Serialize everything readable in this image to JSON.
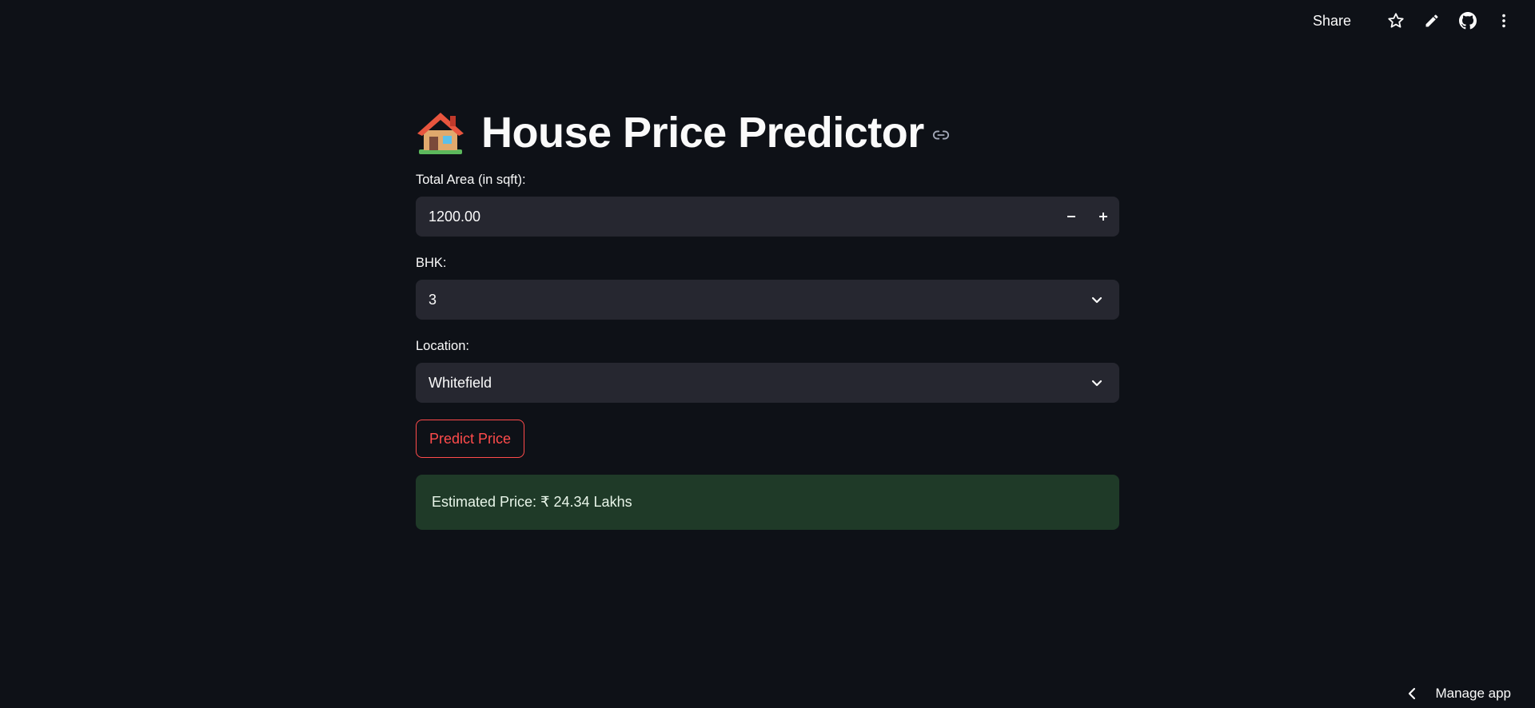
{
  "topbar": {
    "share_label": "Share",
    "icons": [
      "star-icon",
      "pencil-icon",
      "github-icon",
      "more-vertical-icon"
    ]
  },
  "header": {
    "emoji": "🏠",
    "title": "House Price Predictor"
  },
  "form": {
    "area": {
      "label": "Total Area (in sqft):",
      "value": "1200.00",
      "decrement_symbol": "−",
      "increment_symbol": "+"
    },
    "bhk": {
      "label": "BHK:",
      "value": "3"
    },
    "location": {
      "label": "Location:",
      "value": "Whitefield"
    },
    "predict_button_label": "Predict Price"
  },
  "result": {
    "text": "Estimated Price: ₹ 24.34 Lakhs"
  },
  "footer": {
    "manage_app_label": "Manage app"
  },
  "colors": {
    "background": "#0e1117",
    "input_bg": "#262730",
    "accent": "#ff4b4b",
    "success_bg": "#1f3a28"
  }
}
